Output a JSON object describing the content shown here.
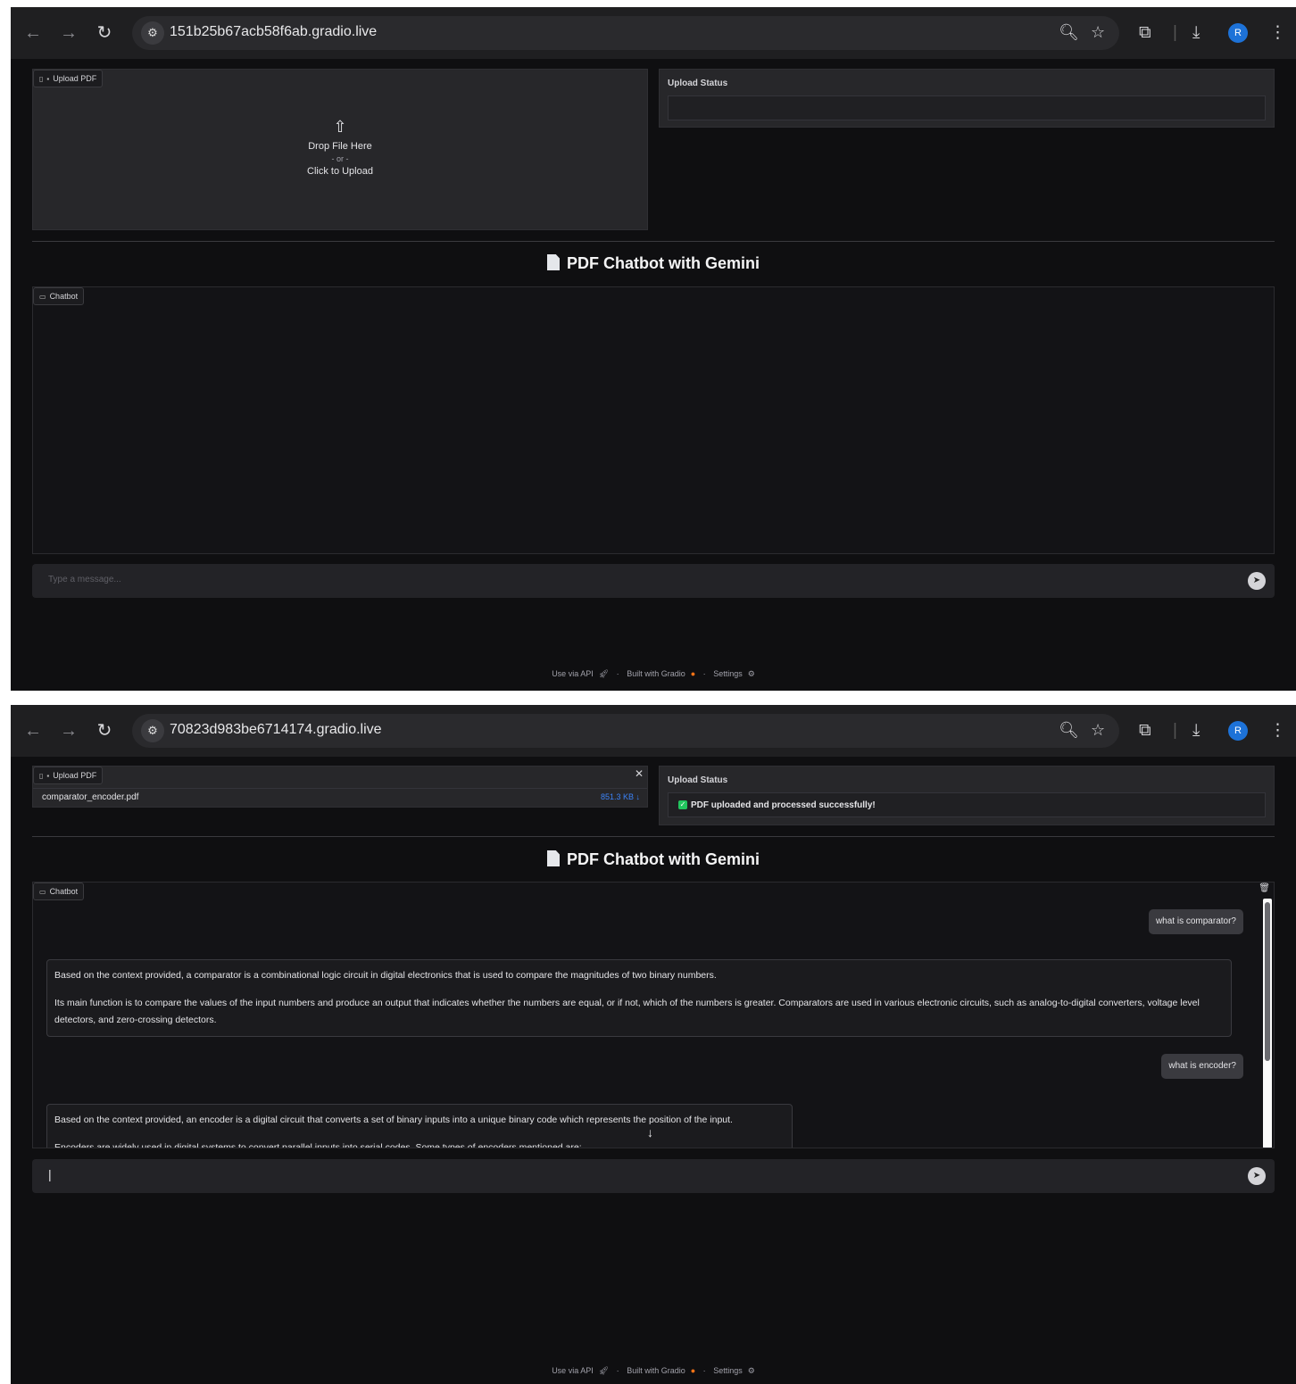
{
  "screens": [
    {
      "url": "151b25b67acb58f6ab.gradio.live",
      "upload": {
        "chip_label": "Upload PDF",
        "drop_text": "Drop File Here",
        "or_text": "- or -",
        "click_text": "Click to Upload"
      },
      "status": {
        "label": "Upload Status",
        "value": ""
      },
      "title": "PDF Chatbot with Gemini",
      "chatbot": {
        "chip_label": "Chatbot"
      },
      "input": {
        "placeholder": "Type a message...",
        "value": ""
      },
      "footer": {
        "api": "Use via API",
        "built": "Built with Gradio",
        "settings": "Settings"
      }
    },
    {
      "url": "70823d983be6714174.gradio.live",
      "upload": {
        "chip_label": "Upload PDF",
        "file_name": "comparator_encoder.pdf",
        "file_size": "851.3 KB ↓"
      },
      "status": {
        "label": "Upload Status",
        "value": "PDF uploaded and processed successfully!"
      },
      "title": "PDF Chatbot with Gemini",
      "chatbot": {
        "chip_label": "Chatbot",
        "messages": [
          {
            "role": "user",
            "text": "what is comparator?"
          },
          {
            "role": "bot",
            "paragraphs": [
              "Based on the context provided, a comparator is a combinational logic circuit in digital electronics that is used to compare the magnitudes of two binary numbers.",
              "Its main function is to compare the values of the input numbers and produce an output that indicates whether the numbers are equal, or if not, which of the numbers is greater. Comparators are used in various electronic circuits, such as analog-to-digital converters, voltage level detectors, and zero-crossing detectors."
            ]
          },
          {
            "role": "user",
            "text": "what is encoder?"
          },
          {
            "role": "bot",
            "paragraphs": [
              "Based on the context provided, an encoder is a digital circuit that converts a set of binary inputs into a unique binary code which represents the position of the input.",
              "Encoders are widely used in digital systems to convert parallel inputs into serial codes. Some types of encoders mentioned are:"
            ]
          }
        ]
      },
      "input": {
        "placeholder": "",
        "value": "|"
      },
      "footer": {
        "api": "Use via API",
        "built": "Built with Gradio",
        "settings": "Settings"
      }
    }
  ],
  "colors": {
    "background": "#0f0f11",
    "panel": "#27272a",
    "avatar": "#1d72d8",
    "success": "#22c55e"
  },
  "icons": {
    "avatar_letter": "R"
  }
}
